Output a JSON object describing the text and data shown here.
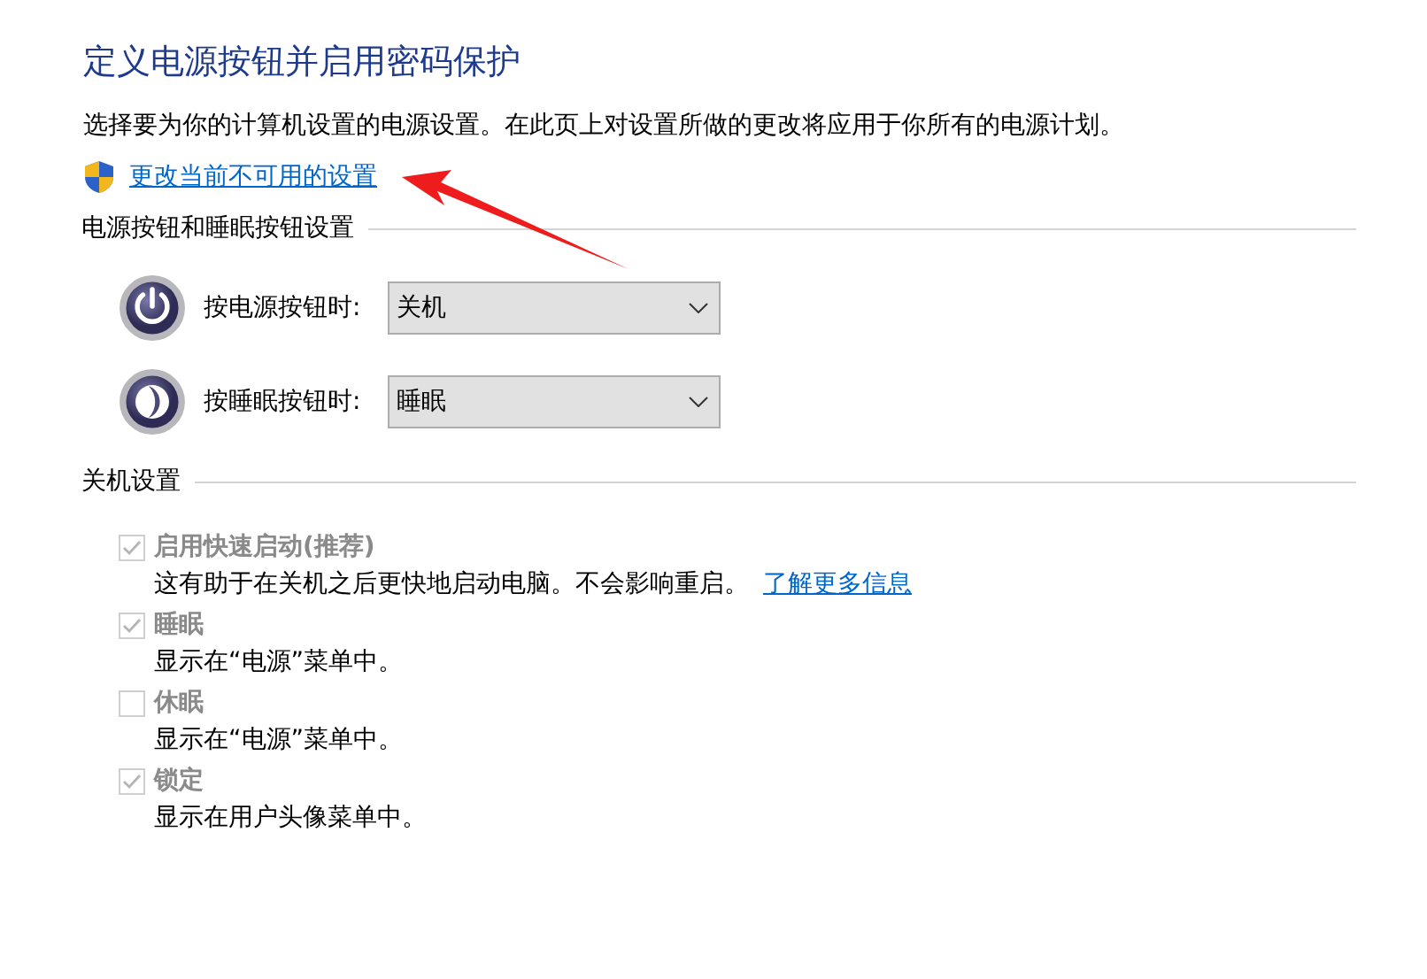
{
  "title": "定义电源按钮并启用密码保护",
  "intro": "选择要为你的计算机设置的电源设置。在此页上对设置所做的更改将应用于你所有的电源计划。",
  "admin_link": "更改当前不可用的设置",
  "button_section": {
    "heading": "电源按钮和睡眠按钮设置",
    "rows": [
      {
        "kind": "power",
        "label": "按电源按钮时:",
        "value": "关机"
      },
      {
        "kind": "sleep",
        "label": "按睡眠按钮时:",
        "value": "睡眠"
      }
    ]
  },
  "shutdown_section": {
    "heading": "关机设置",
    "options": [
      {
        "label": "启用快速启动(推荐)",
        "checked": true,
        "disabled": true,
        "description": "这有助于在关机之后更快地启动电脑。不会影响重启。",
        "link": "了解更多信息"
      },
      {
        "label": "睡眠",
        "checked": true,
        "disabled": true,
        "description": "显示在“电源”菜单中。"
      },
      {
        "label": "休眠",
        "checked": false,
        "disabled": true,
        "description": "显示在“电源”菜单中。"
      },
      {
        "label": "锁定",
        "checked": true,
        "disabled": true,
        "description": "显示在用户头像菜单中。"
      }
    ]
  }
}
